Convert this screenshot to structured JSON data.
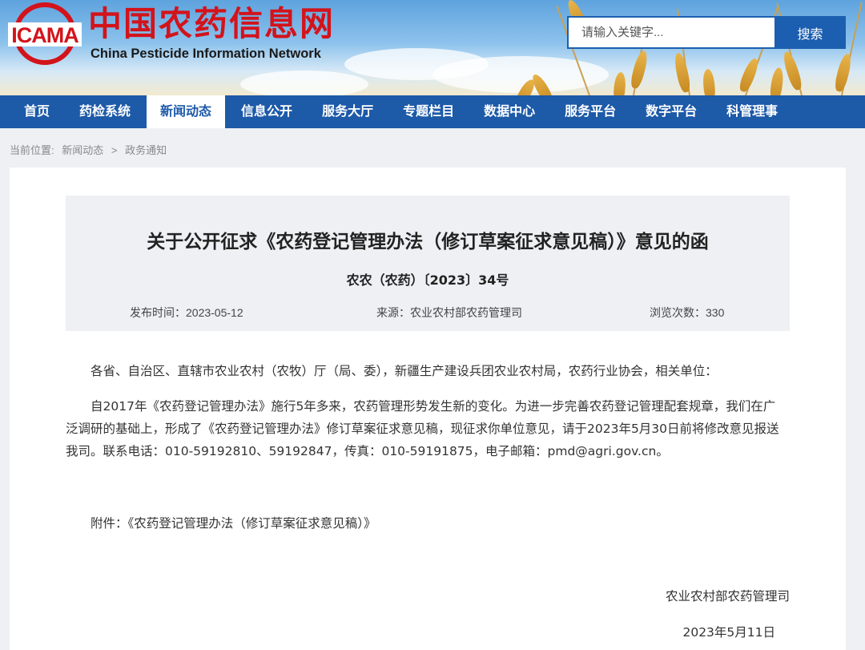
{
  "header": {
    "logo_mark_text": "ICAMA",
    "site_name_cn": "中国农药信息网",
    "site_name_en": "China Pesticide Information Network",
    "search_placeholder": "请输入关键字...",
    "search_button": "搜索"
  },
  "nav": {
    "items": [
      {
        "label": "首页"
      },
      {
        "label": "药检系统"
      },
      {
        "label": "新闻动态",
        "active": true
      },
      {
        "label": "信息公开"
      },
      {
        "label": "服务大厅"
      },
      {
        "label": "专题栏目"
      },
      {
        "label": "数据中心"
      },
      {
        "label": "服务平台"
      },
      {
        "label": "数字平台"
      },
      {
        "label": "科管理事"
      }
    ]
  },
  "breadcrumb": {
    "prefix": "当前位置:",
    "level1": "新闻动态",
    "separator": ">",
    "level2": "政务通知"
  },
  "article": {
    "title": "关于公开征求《农药登记管理办法（修订草案征求意见稿）》意见的函",
    "doc_number": "农农（农药）〔2023〕34号",
    "publish_time": "发布时间：2023-05-12",
    "source": "来源：农业农村部农药管理司",
    "views": "浏览次数：330",
    "salutation": "各省、自治区、直辖市农业农村（农牧）厅（局、委），新疆生产建设兵团农业农村局，农药行业协会，相关单位：",
    "paragraph1_line1": "自2017年《农药登记管理办法》施行5年多来，农药管理形势发生新的变化。为进一步完善农药登记管理配套规章，我们在广",
    "paragraph1_line2": "泛调研的基础上，形成了《农药登记管理办法》修订草案征求意见稿，现征求你单位意见，请于2023年5月30日前将修改意见报送",
    "paragraph1_line3": "我司。联系电话：010-59192810、59192847，传真：010-59191875，电子邮箱：pmd@agri.gov.cn。",
    "attachment_label": "附件：",
    "attachment_link": "《农药登记管理办法（修订草案征求意见稿）》",
    "signature_org": "农业农村部农药管理司",
    "signature_date": "2023年5月11日"
  },
  "colors": {
    "brand_red": "#d3131b",
    "nav_blue": "#1d5aa8",
    "search_blue": "#1c5fb0"
  }
}
